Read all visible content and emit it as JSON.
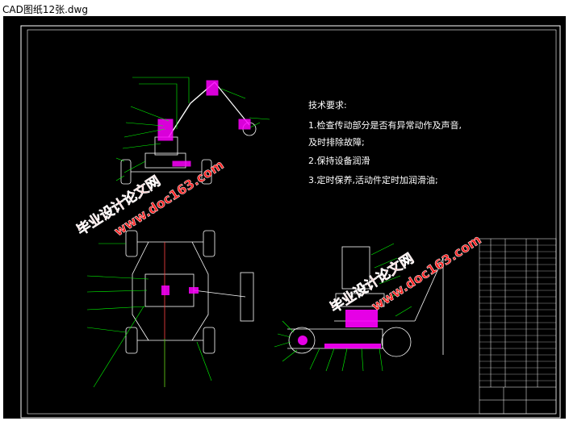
{
  "window": {
    "title": "CAD图纸12张.dwg"
  },
  "drawing": {
    "tech_requirements": {
      "heading": "技术要求:",
      "items": [
        "1.检查传动部分是否有异常动作及声音,",
        "及时排除故障;",
        "2.保持设备润滑",
        "3.定时保养,活动件定时加润滑油;"
      ]
    },
    "watermarks": [
      {
        "line1": "毕业设计论文网",
        "line2": "www.doc163.com"
      },
      {
        "line1": "毕业设计论文网",
        "line2": "www.doc163.com"
      }
    ],
    "colors": {
      "background": "#000000",
      "frame": "#ffffff",
      "leader": "#00ff00",
      "part": "#ff00ff",
      "watermark": "#ff2222",
      "text": "#ffffff"
    }
  }
}
